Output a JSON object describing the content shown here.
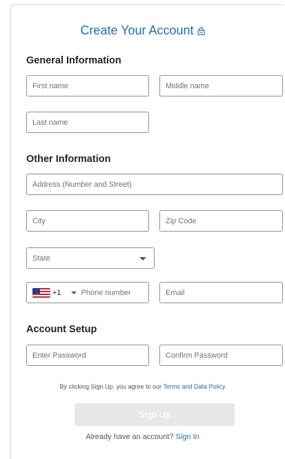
{
  "header": {
    "title": "Create Your Account"
  },
  "sections": {
    "general": "General Information",
    "other": "Other Information",
    "account": "Account Setup"
  },
  "fields": {
    "first_name": "First name",
    "middle_name": "Middle name",
    "last_name": "Last name",
    "address": "Address (Number and Street)",
    "city": "City",
    "zip": "Zip Code",
    "state": "State",
    "country_code": "+1",
    "phone": "Phone number",
    "email": "Email",
    "password": "Enter Password",
    "confirm_password": "Confirm Password"
  },
  "terms": {
    "prefix": "By clicking Sign Up, you agree to our",
    "link": "Terms and Data Policy"
  },
  "buttons": {
    "signup": "Sign Up"
  },
  "footer": {
    "prefix": "Already have an account?",
    "link": "Sign In"
  },
  "colors": {
    "accent": "#1b6fb8",
    "disabled_button": "#e6e7e8"
  }
}
